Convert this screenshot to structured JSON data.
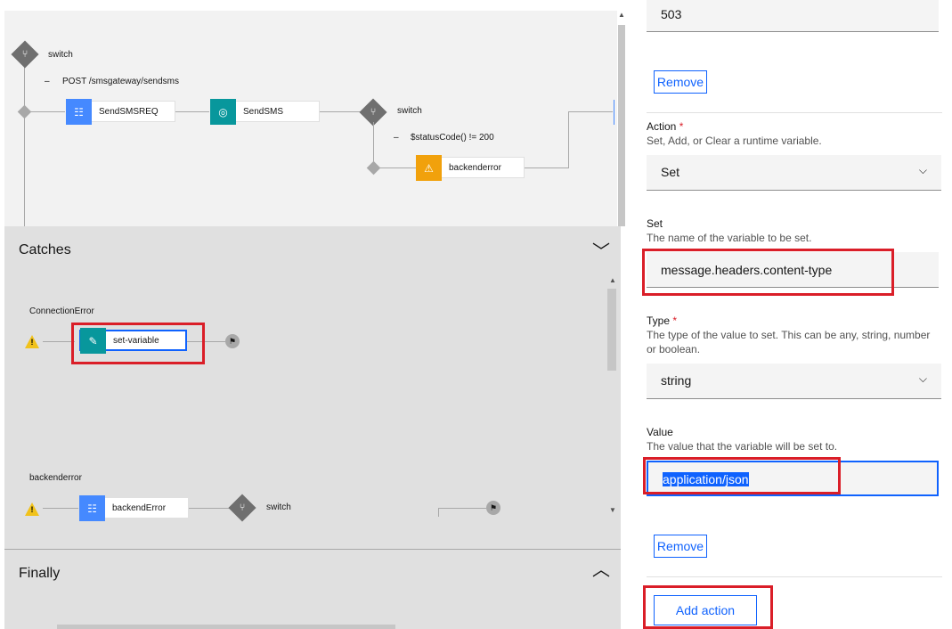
{
  "flow": {
    "switch1_label": "switch",
    "case1_label": "POST /smsgateway/sendsms",
    "node_sendsmsreq": "SendSMSREQ",
    "node_sendsms": "SendSMS",
    "switch2_label": "switch",
    "case2_label": "$statusCode() != 200",
    "node_backenderror": "backenderror"
  },
  "catches": {
    "title": "Catches",
    "connection_error_label": "ConnectionError",
    "node_set_variable": "set-variable",
    "backend_error_label": "backenderror",
    "node_backend_error": "backendError",
    "switch_label": "switch"
  },
  "finally": {
    "title": "Finally"
  },
  "panel": {
    "top_value": "503",
    "remove1": "Remove",
    "action_label": "Action",
    "action_helper": "Set, Add, or Clear a runtime variable.",
    "action_value": "Set",
    "set_label": "Set",
    "set_helper": "The name of the variable to be set.",
    "set_value": "message.headers.content-type",
    "type_label": "Type",
    "type_helper": "The type of the value to set. This can be any, string, number or boolean.",
    "type_value": "string",
    "value_label": "Value",
    "value_helper": "The value that the variable will be set to.",
    "value_value": "application/json",
    "remove2": "Remove",
    "add_action": "Add action",
    "required_mark": "*"
  },
  "colors": {
    "accent": "#0f62fe",
    "highlight": "#da1e28",
    "node_blue": "#4589ff",
    "node_teal": "#08979c",
    "node_orange": "#f1a10c"
  }
}
